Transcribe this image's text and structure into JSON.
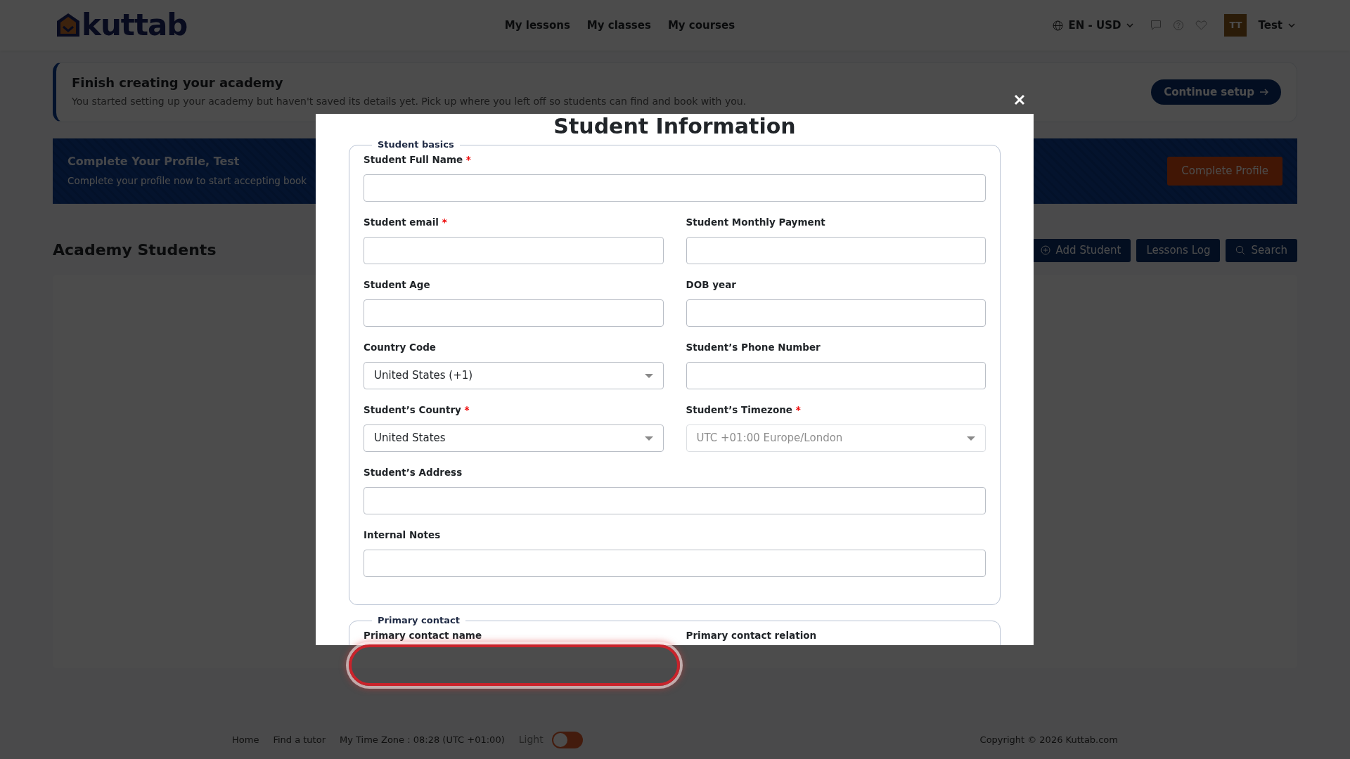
{
  "header": {
    "logo": "kuttab",
    "nav": [
      {
        "label": "My lessons"
      },
      {
        "label": "My classes"
      },
      {
        "label": "My courses"
      }
    ],
    "locale": "EN - USD",
    "user": {
      "initials": "TT",
      "name": "Test"
    }
  },
  "setup_banner": {
    "title": "Finish creating your academy",
    "text": "You started setting up your academy but haven't saved its details yet. Pick up where you left off so students can find and book with you.",
    "button": "Continue setup"
  },
  "profile_banner": {
    "title": "Complete Your Profile, Test",
    "text": "Complete your profile now to start accepting book",
    "button": "Complete Profile"
  },
  "students": {
    "title": "Academy Students",
    "buttons": [
      {
        "label": "Add Student",
        "kind": "add"
      },
      {
        "label": "Lessons Log",
        "kind": "plain"
      },
      {
        "label": "Search",
        "kind": "search"
      }
    ]
  },
  "footer": {
    "links": [
      "Home",
      "Find a tutor"
    ],
    "time_zone": "My Time Zone : 08:28 (UTC +01:00)",
    "theme": {
      "label": "Light",
      "on": false
    },
    "copyright": "Copyright © 2026 Kuttab.com"
  },
  "modal": {
    "title": "Student Information",
    "sections": [
      {
        "legend": "Student basics",
        "rows": [
          [
            {
              "label": "Student Full Name",
              "required_mark": "*",
              "kind": "text",
              "disabled": false,
              "invalid": false
            }
          ],
          [
            {
              "label": "Student email",
              "required_mark": "*",
              "kind": "text",
              "disabled": false,
              "invalid": false
            },
            {
              "label": "Student Monthly Payment",
              "kind": "text",
              "disabled": false,
              "invalid": false
            }
          ],
          [
            {
              "label": "Student Age",
              "kind": "text",
              "disabled": false,
              "invalid": false
            },
            {
              "label": "DOB year",
              "kind": "text",
              "disabled": false,
              "invalid": false
            }
          ],
          [
            {
              "label": "Country Code",
              "kind": "select",
              "value": "United States (+1)",
              "disabled": false,
              "invalid": false
            },
            {
              "label": "Student’s Phone Number",
              "kind": "text",
              "disabled": false,
              "invalid": false
            }
          ],
          [
            {
              "label": "Student’s Country",
              "required_mark": "*",
              "kind": "select",
              "value": "United States",
              "disabled": false,
              "invalid": false
            },
            {
              "label": "Student’s Timezone",
              "required_mark": "*",
              "kind": "select",
              "value": "UTC +01:00 Europe/London",
              "disabled": true,
              "invalid": false
            }
          ],
          [
            {
              "label": "Student’s Address",
              "kind": "text",
              "disabled": false,
              "invalid": false
            }
          ],
          [
            {
              "label": "Internal Notes",
              "kind": "text",
              "disabled": false,
              "invalid": false
            }
          ]
        ]
      },
      {
        "legend": "Primary contact",
        "rows": [
          [
            {
              "label": "Primary contact name",
              "kind": "text",
              "disabled": false,
              "invalid": true
            },
            {
              "label": "Primary contact relation"
            }
          ]
        ]
      }
    ]
  }
}
